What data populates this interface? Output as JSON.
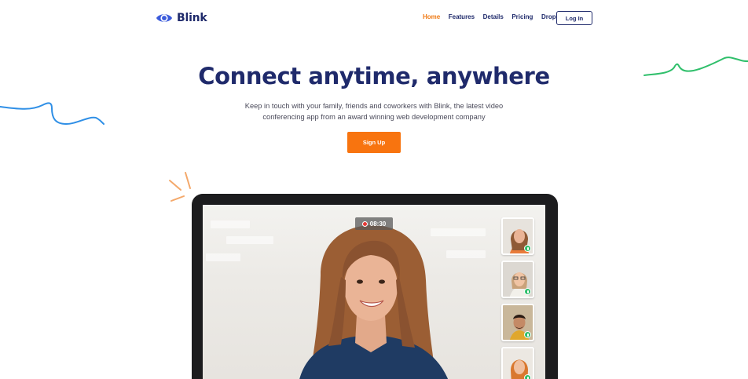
{
  "brand": {
    "name": "Blink",
    "icon": "eye-icon",
    "color": "#3b5bdb"
  },
  "nav": {
    "items": [
      {
        "label": "Home",
        "active": true
      },
      {
        "label": "Features",
        "active": false
      },
      {
        "label": "Details",
        "active": false
      },
      {
        "label": "Pricing",
        "active": false
      },
      {
        "label": "Drop",
        "active": false,
        "has_dropdown": true
      }
    ],
    "login_label": "Log In"
  },
  "hero": {
    "title": "Connect anytime, anywhere",
    "subtitle_line1": "Keep in touch with your family, friends and coworkers with Blink, the latest video",
    "subtitle_line2": "conferencing app from an award winning web development company",
    "signup_label": "Sign Up"
  },
  "call": {
    "timer": "08:30",
    "participants": 4
  },
  "colors": {
    "primary": "#1f2a6b",
    "accent": "#f8740f",
    "blue_squiggle": "#2f8fe6",
    "green_squiggle": "#2fbf6b",
    "mic_badge": "#2fbf6b"
  }
}
